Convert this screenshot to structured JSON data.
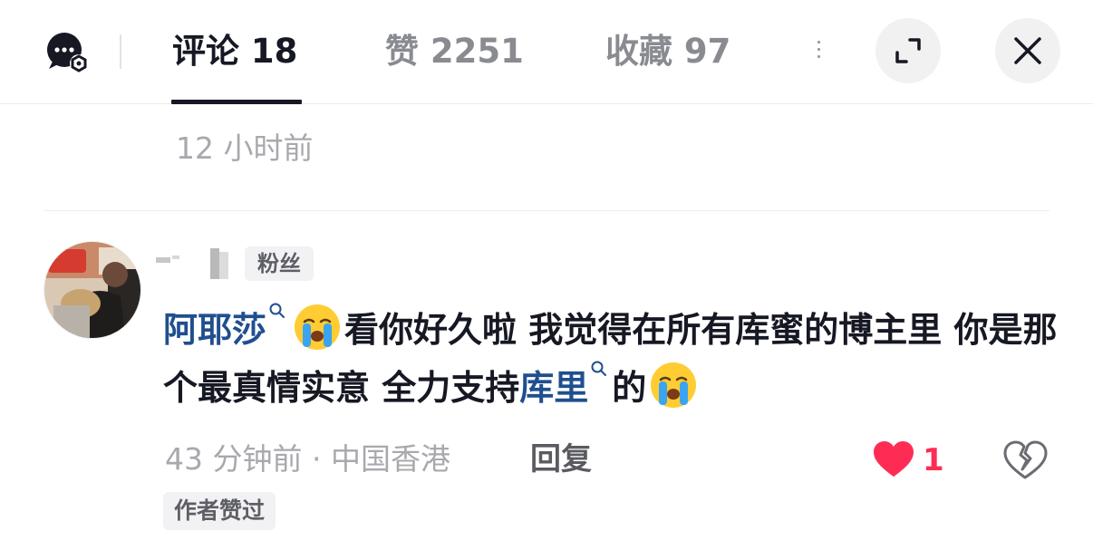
{
  "header": {
    "tabs": [
      {
        "label": "评论 18",
        "active": true
      },
      {
        "label": "赞 2251",
        "active": false
      },
      {
        "label": "收藏 97",
        "active": false
      }
    ],
    "chat_icon": "chat-settings-icon",
    "expand_icon": "expand-icon",
    "close_icon": "close-icon"
  },
  "previous_comment": {
    "time": "12 小时前"
  },
  "comment": {
    "badge": "粉丝",
    "mention1": "阿耶莎",
    "text1": "看你好久啦 我觉得在所有库蜜的博主里 你是那个最真情实意 全力支持",
    "mention2": "库里",
    "text2": "的",
    "emoji": "loudly-crying-face",
    "meta": "43 分钟前 · 中国香港",
    "reply_label": "回复",
    "like_count": "1",
    "author_liked": "作者赞过"
  },
  "colors": {
    "accent_like": "#fe2c55",
    "mention": "#1f4f8f",
    "secondary_text": "#a8a9ae"
  }
}
